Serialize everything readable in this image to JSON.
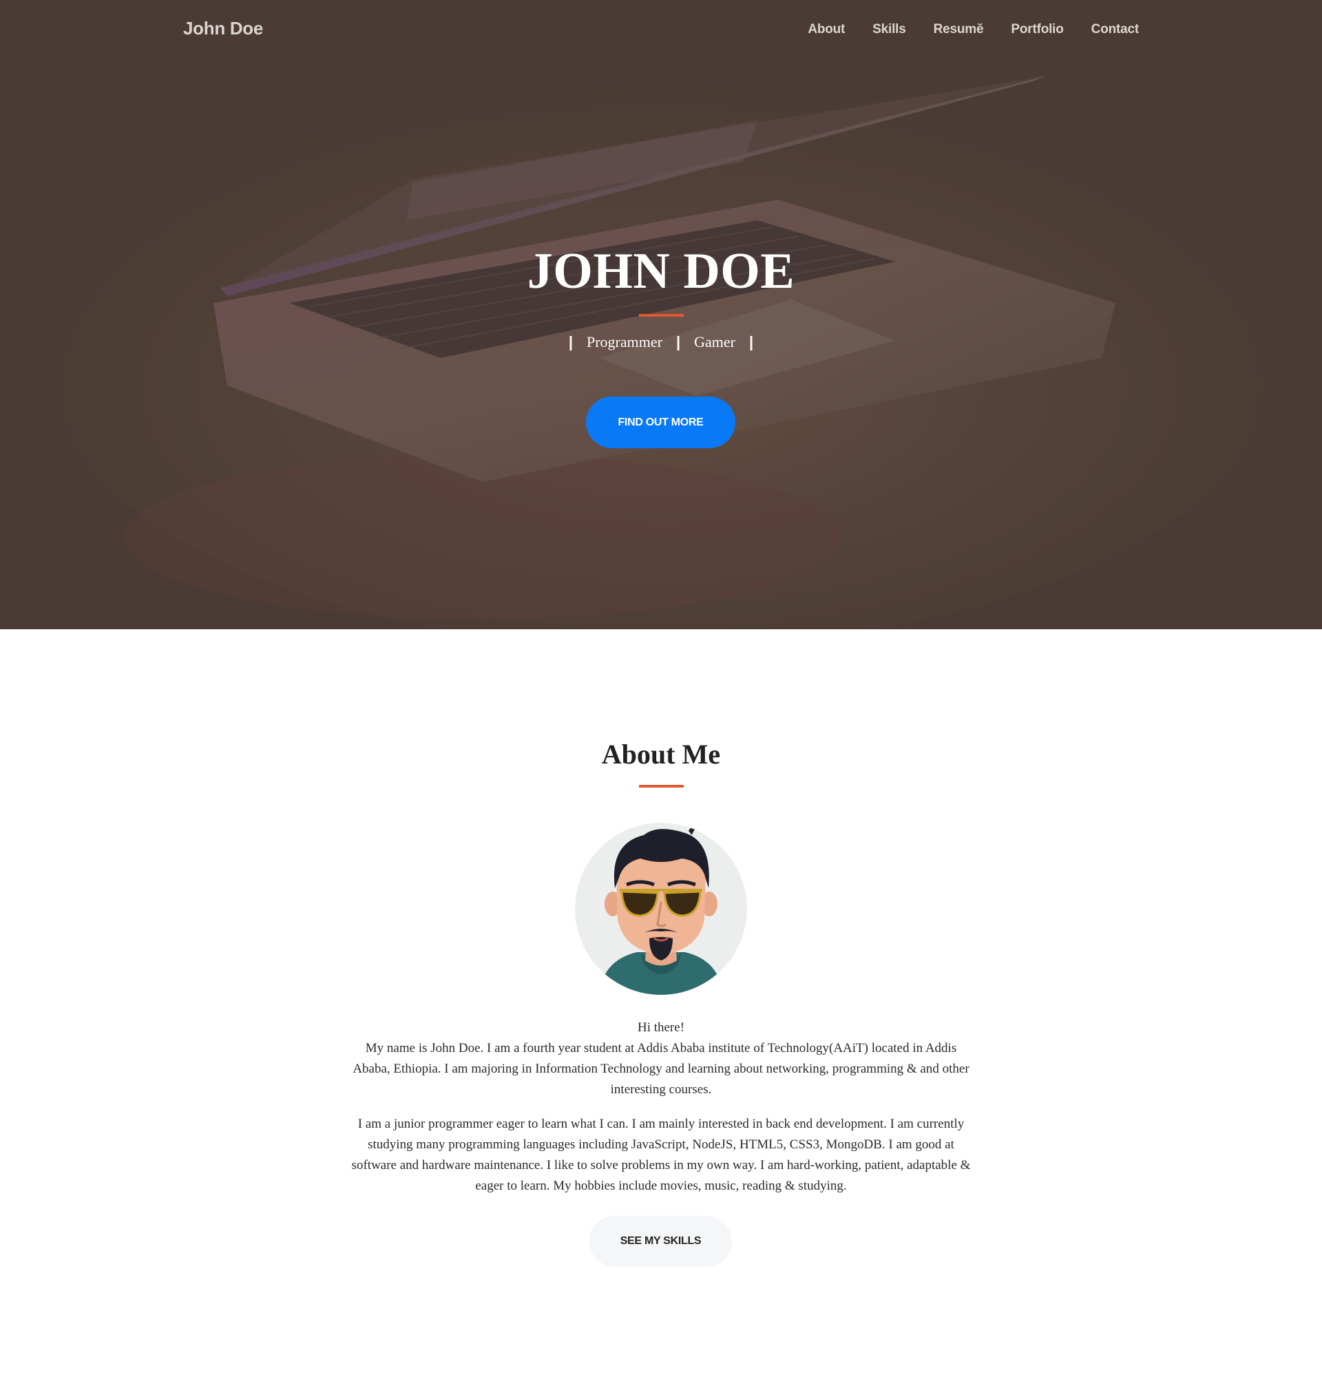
{
  "navbar": {
    "brand": "John Doe",
    "links": [
      "About",
      "Skills",
      "Resumĕ",
      "Portfolio",
      "Contact"
    ]
  },
  "hero": {
    "title": "JOHN DOE",
    "tagline_separator": "|",
    "tagline": [
      "Programmer",
      "Gamer"
    ],
    "button_label": "FIND OUT MORE"
  },
  "about": {
    "title": "About Me",
    "greeting": "Hi there!",
    "paragraph1": "My name is John Doe. I am a fourth year student at Addis Ababa institute of Technology(AAiT) located in Addis Ababa, Ethiopia. I am majoring in Information Technology and learning about networking, programming & and other interesting courses.",
    "paragraph2": "I am a junior programmer eager to learn what I can. I am mainly interested in back end development. I am currently studying many programming languages including JavaScript, NodeJS, HTML5, CSS3, MongoDB. I am good at software and hardware maintenance. I like to solve problems in my own way. I am hard-working, patient, adaptable & eager to learn. My hobbies include movies, music, reading & studying.",
    "button_label": "SEE MY SKILLS"
  },
  "colors": {
    "hero_overlay": "#4a3d35",
    "accent": "#e05a30",
    "primary_button": "#0a79f5",
    "secondary_button": "#f5f6f7"
  },
  "icons": {
    "avatar": "cartoon-man-sunglasses-avatar",
    "hero_background": "laptop-photo"
  }
}
